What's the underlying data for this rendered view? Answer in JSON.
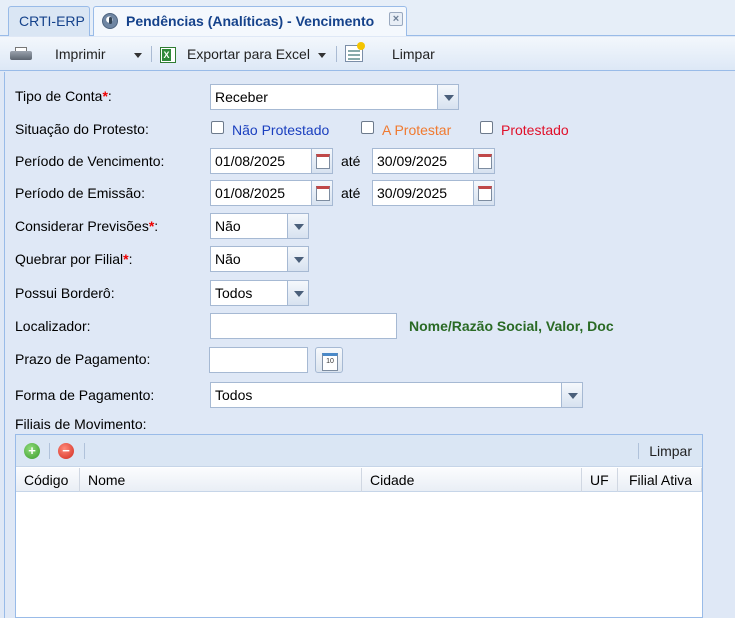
{
  "tabs": [
    {
      "label": "CRTI-ERP"
    },
    {
      "label": "Pendências (Analíticas) - Vencimento",
      "close": "×"
    }
  ],
  "toolbar": {
    "print_label": "Imprimir",
    "export_label": "Exportar para Excel",
    "clear_label": "Limpar"
  },
  "form": {
    "tipo_conta": {
      "label": "Tipo de Conta",
      "required": "*",
      "suffix": ":",
      "value": "Receber"
    },
    "situacao_protesto": {
      "label": "Situação do Protesto:",
      "options": [
        {
          "label": "Não Protestado",
          "color": "#1a3fbf"
        },
        {
          "label": "A Protestar",
          "color": "#f07a30"
        },
        {
          "label": "Protestado",
          "color": "#e0102a"
        }
      ]
    },
    "periodo_vencimento": {
      "label": "Período de Vencimento:",
      "from": "01/08/2025",
      "sep": "até",
      "to": "30/09/2025"
    },
    "periodo_emissao": {
      "label": "Período de Emissão:",
      "from": "01/08/2025",
      "sep": "até",
      "to": "30/09/2025"
    },
    "considerar_previsoes": {
      "label": "Considerar Previsões",
      "required": "*",
      "suffix": ":",
      "value": "Não"
    },
    "quebrar_filial": {
      "label": "Quebrar por Filial",
      "required": "*",
      "suffix": ":",
      "value": "Não"
    },
    "possui_bordero": {
      "label": "Possui Borderô:",
      "value": "Todos"
    },
    "localizador": {
      "label": "Localizador:",
      "value": "",
      "hint": "Nome/Razão Social, Valor, Doc"
    },
    "prazo_pagamento": {
      "label": "Prazo de Pagamento:",
      "value": ""
    },
    "forma_pagamento": {
      "label": "Forma de Pagamento:",
      "value": "Todos"
    },
    "filiais_label": "Filiais de Movimento:"
  },
  "grid": {
    "clear_label": "Limpar",
    "columns": [
      "Código",
      "Nome",
      "Cidade",
      "UF",
      "Filial Ativa"
    ]
  }
}
